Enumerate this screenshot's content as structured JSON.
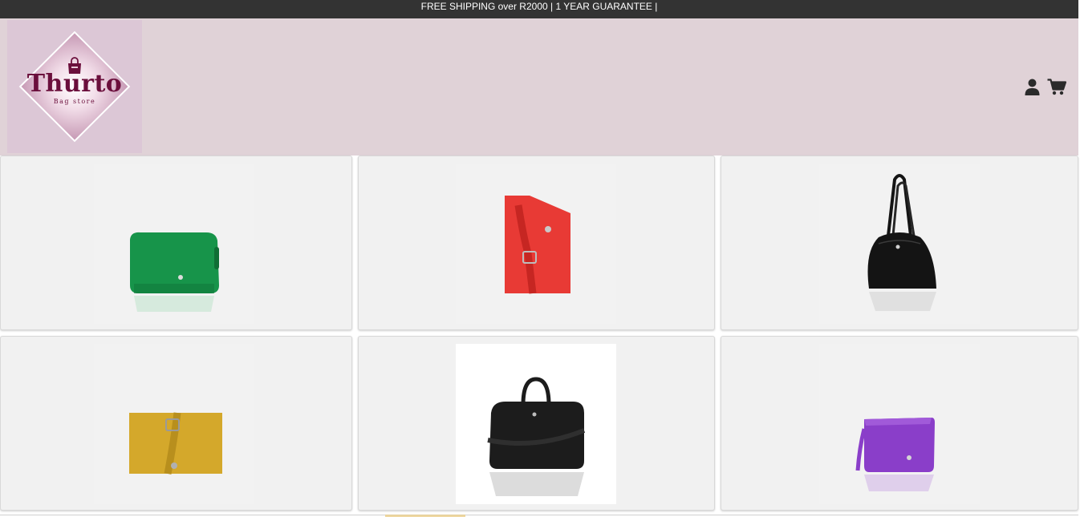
{
  "announcement": "FREE SHIPPING over R2000 | 1 YEAR GUARANTEE |",
  "brand": {
    "name": "Thurto",
    "tagline": "Bag store",
    "color": "#6b0f3c"
  },
  "header_icons": [
    "user-icon",
    "cart-icon"
  ],
  "colors": {
    "topbar": "#333333",
    "header": "#e0d2d7",
    "card": "#f1f1f1"
  },
  "products": [
    {
      "name": "green-crossbody-bag",
      "color": "#17944a"
    },
    {
      "name": "red-bag-closeup",
      "color": "#e83a35"
    },
    {
      "name": "black-shoulder-bag",
      "color": "#141414"
    },
    {
      "name": "mustard-bag-closeup",
      "color": "#d4a82b"
    },
    {
      "name": "black-laptop-bag",
      "color": "#1c1c1c"
    },
    {
      "name": "purple-crossbody-bag",
      "color": "#8a3ec9"
    }
  ]
}
